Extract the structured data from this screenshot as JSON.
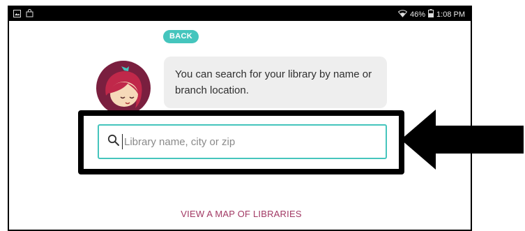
{
  "statusbar": {
    "battery": "46%",
    "time": "1:08 PM",
    "icons": [
      "gallery-icon",
      "shopping-bag-icon",
      "wifi-icon",
      "battery-icon"
    ]
  },
  "back_button": {
    "label": "BACK"
  },
  "message": {
    "text": "You can search for your library by name or branch location."
  },
  "search": {
    "placeholder": "Library name, city or zip",
    "value": ""
  },
  "map_link": {
    "label": "VIEW A MAP OF LIBRARIES"
  },
  "colors": {
    "accent": "#45c5bd",
    "link": "#a13863",
    "avatar_bg": "#7a1f3f",
    "hair": "#c0284a"
  }
}
